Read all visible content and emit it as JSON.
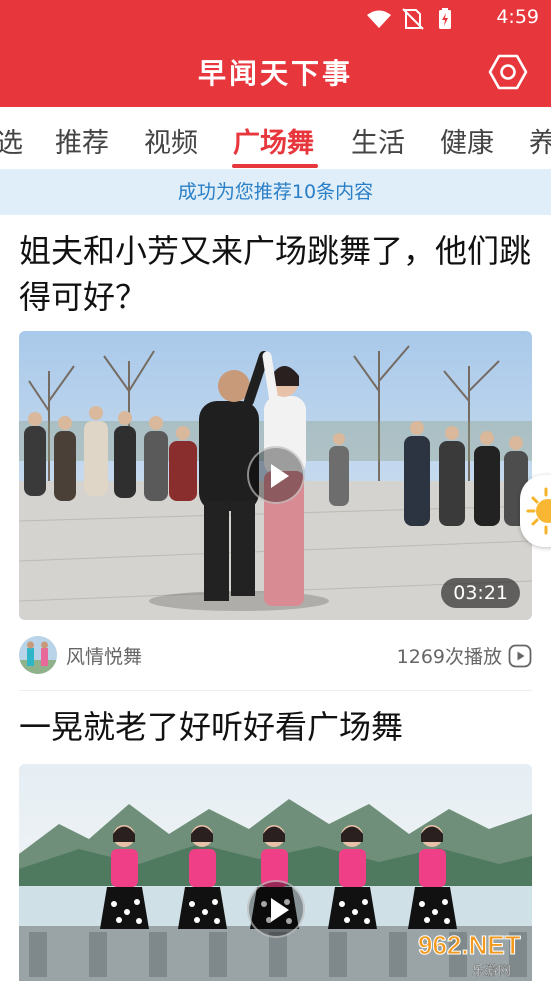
{
  "status_bar": {
    "time": "4:59",
    "icons": [
      "wifi-icon",
      "no-sim-icon",
      "battery-charging-icon"
    ]
  },
  "app_bar": {
    "title": "早闻天下事",
    "settings_icon": "settings-hexagon-icon"
  },
  "tabs": {
    "items": [
      {
        "label": "选",
        "active": false
      },
      {
        "label": "推荐",
        "active": false
      },
      {
        "label": "视频",
        "active": false
      },
      {
        "label": "广场舞",
        "active": true
      },
      {
        "label": "生活",
        "active": false
      },
      {
        "label": "健康",
        "active": false
      },
      {
        "label": "养",
        "active": false
      }
    ],
    "active_color": "#e8373c"
  },
  "toast": {
    "text": "成功为您推荐10条内容"
  },
  "feed": {
    "items": [
      {
        "title": "姐夫和小芳又来广场跳舞了，他们跳得可好？",
        "duration": "03:21",
        "author": "风情悦舞",
        "plays": "1269次播放",
        "play_icon": "play-circle-icon"
      },
      {
        "title": "一晃就老了好听好看广场舞"
      }
    ]
  },
  "floating_widget": {
    "icon": "sun-icon"
  },
  "watermark": {
    "text": "962.NET 乐游网"
  },
  "colors": {
    "brand_red": "#e8373c",
    "toast_bg": "#dfeef8",
    "toast_text": "#2a7fc6"
  }
}
